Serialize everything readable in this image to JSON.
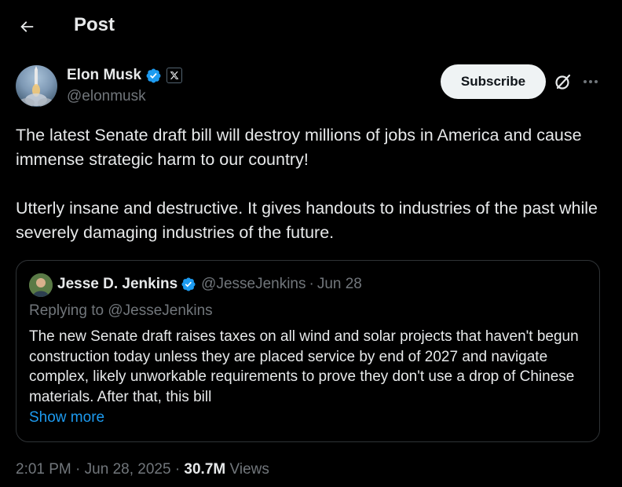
{
  "header": {
    "back_icon": "arrow-left-icon",
    "title": "Post"
  },
  "post": {
    "author": {
      "name": "Elon Musk",
      "handle": "@elonmusk",
      "verified_color": "#1d9bf0",
      "affiliate_badge": "x-logo-icon"
    },
    "actions": {
      "subscribe_label": "Subscribe",
      "grok_icon": "grok-icon",
      "more_icon": "more-options-icon"
    },
    "paragraphs": [
      "The latest Senate draft bill will destroy millions of jobs in America and cause immense strategic harm to our country!",
      "Utterly insane and destructive. It gives handouts to industries of the past while severely damaging industries of the future."
    ],
    "quote": {
      "name": "Jesse D. Jenkins",
      "handle": "@JesseJenkins",
      "separator": "·",
      "date": "Jun 28",
      "replying_to": "Replying to @JesseJenkins",
      "text": "The new Senate draft raises taxes on all wind and solar projects that haven't begun construction today unless they are placed service by end of 2027 and navigate complex, likely unworkable requirements to prove they don't use a drop of Chinese materials. After that, this bill",
      "show_more": "Show more"
    },
    "meta": {
      "time": "2:01 PM",
      "separator": "·",
      "date": "Jun 28, 2025",
      "views_count": "30.7M",
      "views_label": "Views"
    }
  },
  "colors": {
    "background": "#000000",
    "text_primary": "#e7e9ea",
    "text_secondary": "#71767b",
    "accent": "#1d9bf0",
    "border": "#2f3336"
  }
}
